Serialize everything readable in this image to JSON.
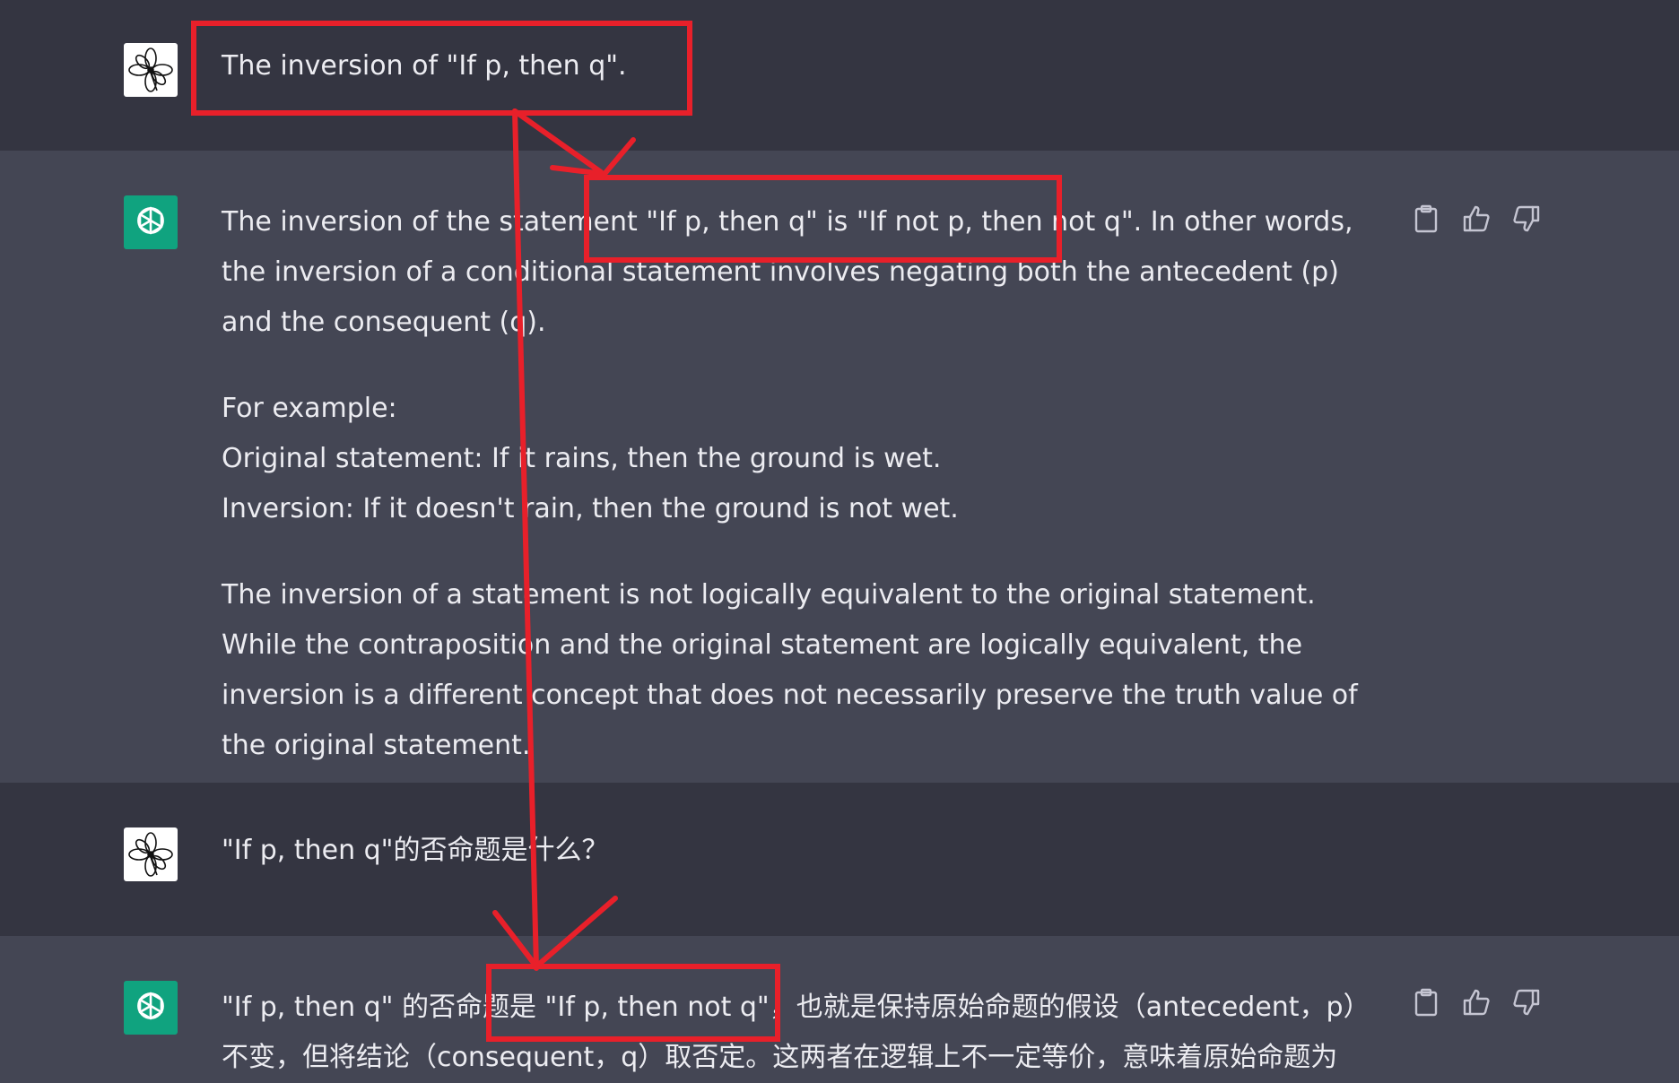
{
  "messages": [
    {
      "role": "user",
      "avatar_icon": "flower-avatar-icon",
      "text": "The inversion of \"If p, then q\"."
    },
    {
      "role": "assistant",
      "avatar_icon": "chatgpt-logo-icon",
      "paragraphs": [
        "The inversion of the statement \"If p, then q\" is \"If not p, then not q\". In other words, the inversion of a conditional statement involves negating both the antecedent (p) and the consequent (q).",
        "For example:",
        "Original statement: If it rains, then the ground is wet.",
        "Inversion: If it doesn't rain, then the ground is not wet.",
        "The inversion of a statement is not logically equivalent to the original statement. While the contraposition and the original statement are logically equivalent, the inversion is a different concept that does not necessarily preserve the truth value of the original statement."
      ],
      "actions": [
        "clipboard-icon",
        "thumbs-up-icon",
        "thumbs-down-icon"
      ]
    },
    {
      "role": "user",
      "avatar_icon": "flower-avatar-icon",
      "text": "\"If p, then q\"的否命题是什么？"
    },
    {
      "role": "assistant",
      "avatar_icon": "chatgpt-logo-icon",
      "paragraphs": [
        "\"If p, then q\" 的否命题是 \"If p, then not q\"，也就是保持原始命题的假设（antecedent，p）不变，但将结论（consequent，q）取否定。这两者在逻辑上不一定等价，意味着原始命题为"
      ],
      "actions": [
        "clipboard-icon",
        "thumbs-up-icon",
        "thumbs-down-icon"
      ]
    }
  ],
  "annotation_color": "#e8202a",
  "colors": {
    "user_row_bg": "#343541",
    "assistant_row_bg": "#444654",
    "text": "#ececf1",
    "gpt_avatar_bg": "#10a37f"
  }
}
